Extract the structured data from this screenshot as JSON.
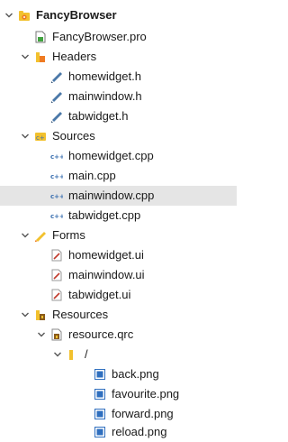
{
  "project": {
    "name": "FancyBrowser",
    "icon": "qt-project-icon",
    "pro_file": "FancyBrowser.pro",
    "headers": {
      "label": "Headers",
      "files": [
        "homewidget.h",
        "mainwindow.h",
        "tabwidget.h"
      ]
    },
    "sources": {
      "label": "Sources",
      "files": [
        "homewidget.cpp",
        "main.cpp",
        "mainwindow.cpp",
        "tabwidget.cpp"
      ],
      "selected": "mainwindow.cpp"
    },
    "forms": {
      "label": "Forms",
      "files": [
        "homewidget.ui",
        "mainwindow.ui",
        "tabwidget.ui"
      ]
    },
    "resources": {
      "label": "Resources",
      "qrc": "resource.qrc",
      "prefix": "/",
      "files": [
        "back.png",
        "favourite.png",
        "forward.png",
        "reload.png"
      ]
    }
  },
  "colors": {
    "selection": "#e5e5e5",
    "arrow": "#555555",
    "folder_yellow": "#f2c12e",
    "folder_orange": "#ef7b22",
    "header_icon": "#4b78a8",
    "cpp_icon": "#3a6fb0",
    "form_icon": "#c0392b",
    "image_icon": "#2f6fbf"
  }
}
